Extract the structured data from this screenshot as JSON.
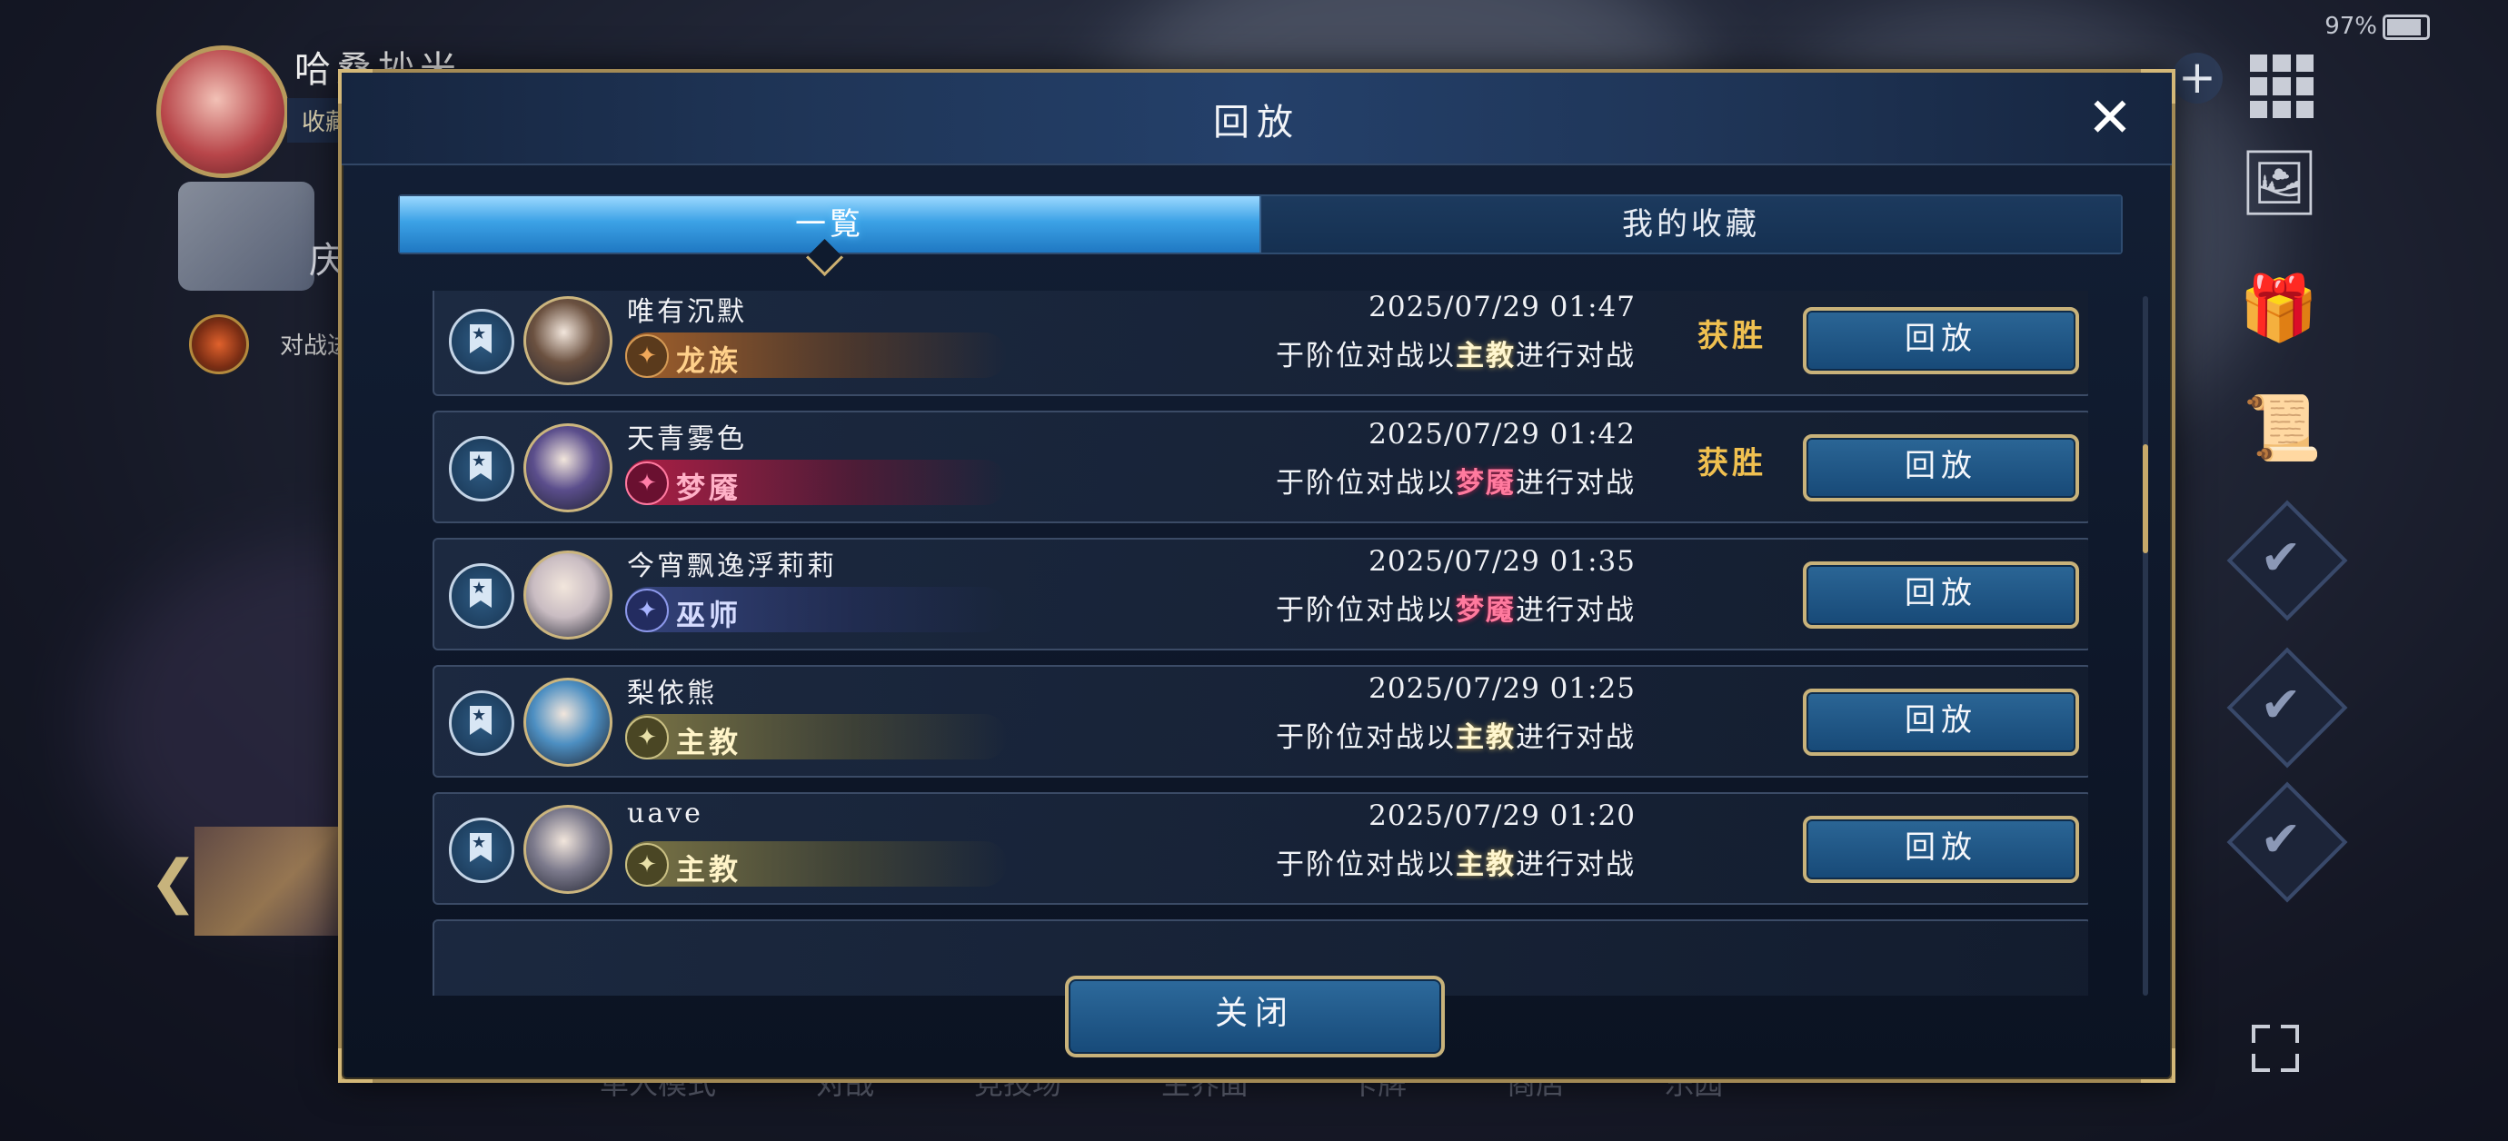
{
  "status_bar": {
    "battery": "97%"
  },
  "hud": {
    "player_name": "哈桑抄米",
    "tag": "收藏",
    "character_label": "庆典",
    "rank_label": "对战进行位",
    "bottom_nav": [
      "单人模式",
      "对战",
      "竞技场",
      "主界面",
      "卡牌",
      "商店",
      "乐园"
    ]
  },
  "modal": {
    "title": "回放",
    "close_icon": "close-icon",
    "tabs": [
      {
        "label": "一覧",
        "active": true
      },
      {
        "label": "我的收藏",
        "active": false
      }
    ],
    "rows": [
      {
        "name": "唯有沉默",
        "class": "龙族",
        "class_type": "dragon",
        "avatar_color": "#6b5140",
        "time": "2025/07/29  01:47",
        "desc_prefix": "于阶位对战以",
        "desc_class": "主教",
        "desc_class_type": "bishop",
        "desc_suffix": "进行对战",
        "result": "获胜",
        "button": "回放"
      },
      {
        "name": "天青雾色",
        "class": "梦魇",
        "class_type": "nightmare",
        "avatar_color": "#5b4e8c",
        "time": "2025/07/29  01:42",
        "desc_prefix": "于阶位对战以",
        "desc_class": "梦魇",
        "desc_class_type": "nightmare",
        "desc_suffix": "进行对战",
        "result": "获胜",
        "button": "回放"
      },
      {
        "name": "今宵飘逸浮莉莉",
        "class": "巫师",
        "class_type": "wizard",
        "avatar_color": "#c9bcc2",
        "time": "2025/07/29  01:35",
        "desc_prefix": "于阶位对战以",
        "desc_class": "梦魇",
        "desc_class_type": "nightmare",
        "desc_suffix": "进行对战",
        "result": "",
        "button": "回放"
      },
      {
        "name": "梨依熊",
        "class": "主教",
        "class_type": "bishop",
        "avatar_color": "#4d8fc2",
        "time": "2025/07/29  01:25",
        "desc_prefix": "于阶位对战以",
        "desc_class": "主教",
        "desc_class_type": "bishop",
        "desc_suffix": "进行对战",
        "result": "",
        "button": "回放"
      },
      {
        "name": "uave",
        "class": "主教",
        "class_type": "bishop",
        "avatar_color": "#7c7a8c",
        "time": "2025/07/29  01:20",
        "desc_prefix": "于阶位对战以",
        "desc_class": "主教",
        "desc_class_type": "bishop",
        "desc_suffix": "进行对战",
        "result": "",
        "button": "回放"
      }
    ],
    "scroll_fraction": 0.25,
    "footer_button": "关闭"
  }
}
